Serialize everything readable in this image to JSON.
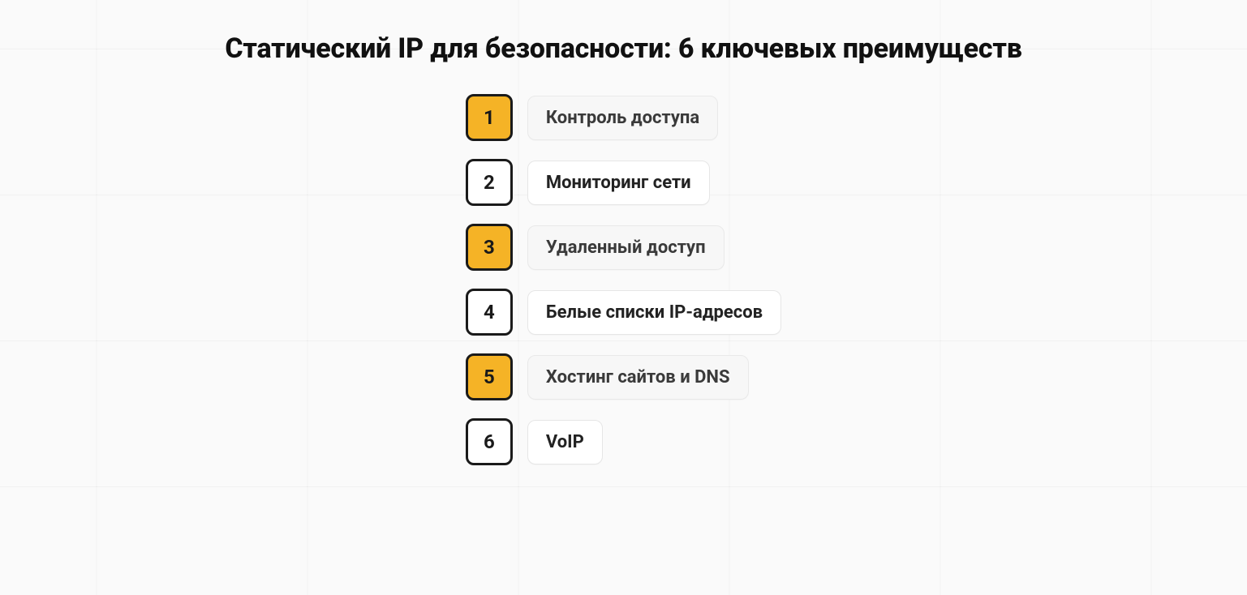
{
  "title": "Статический IP для безопасности: 6 ключевых преимуществ",
  "accent_color": "#f5b326",
  "items": [
    {
      "n": "1",
      "label": "Контроль доступа",
      "highlight": true
    },
    {
      "n": "2",
      "label": "Мониторинг сети",
      "highlight": false
    },
    {
      "n": "3",
      "label": "Удаленный доступ",
      "highlight": true
    },
    {
      "n": "4",
      "label": "Белые списки IP-адресов",
      "highlight": false
    },
    {
      "n": "5",
      "label": "Хостинг сайтов и DNS",
      "highlight": true
    },
    {
      "n": "6",
      "label": "VoIP",
      "highlight": false
    }
  ]
}
